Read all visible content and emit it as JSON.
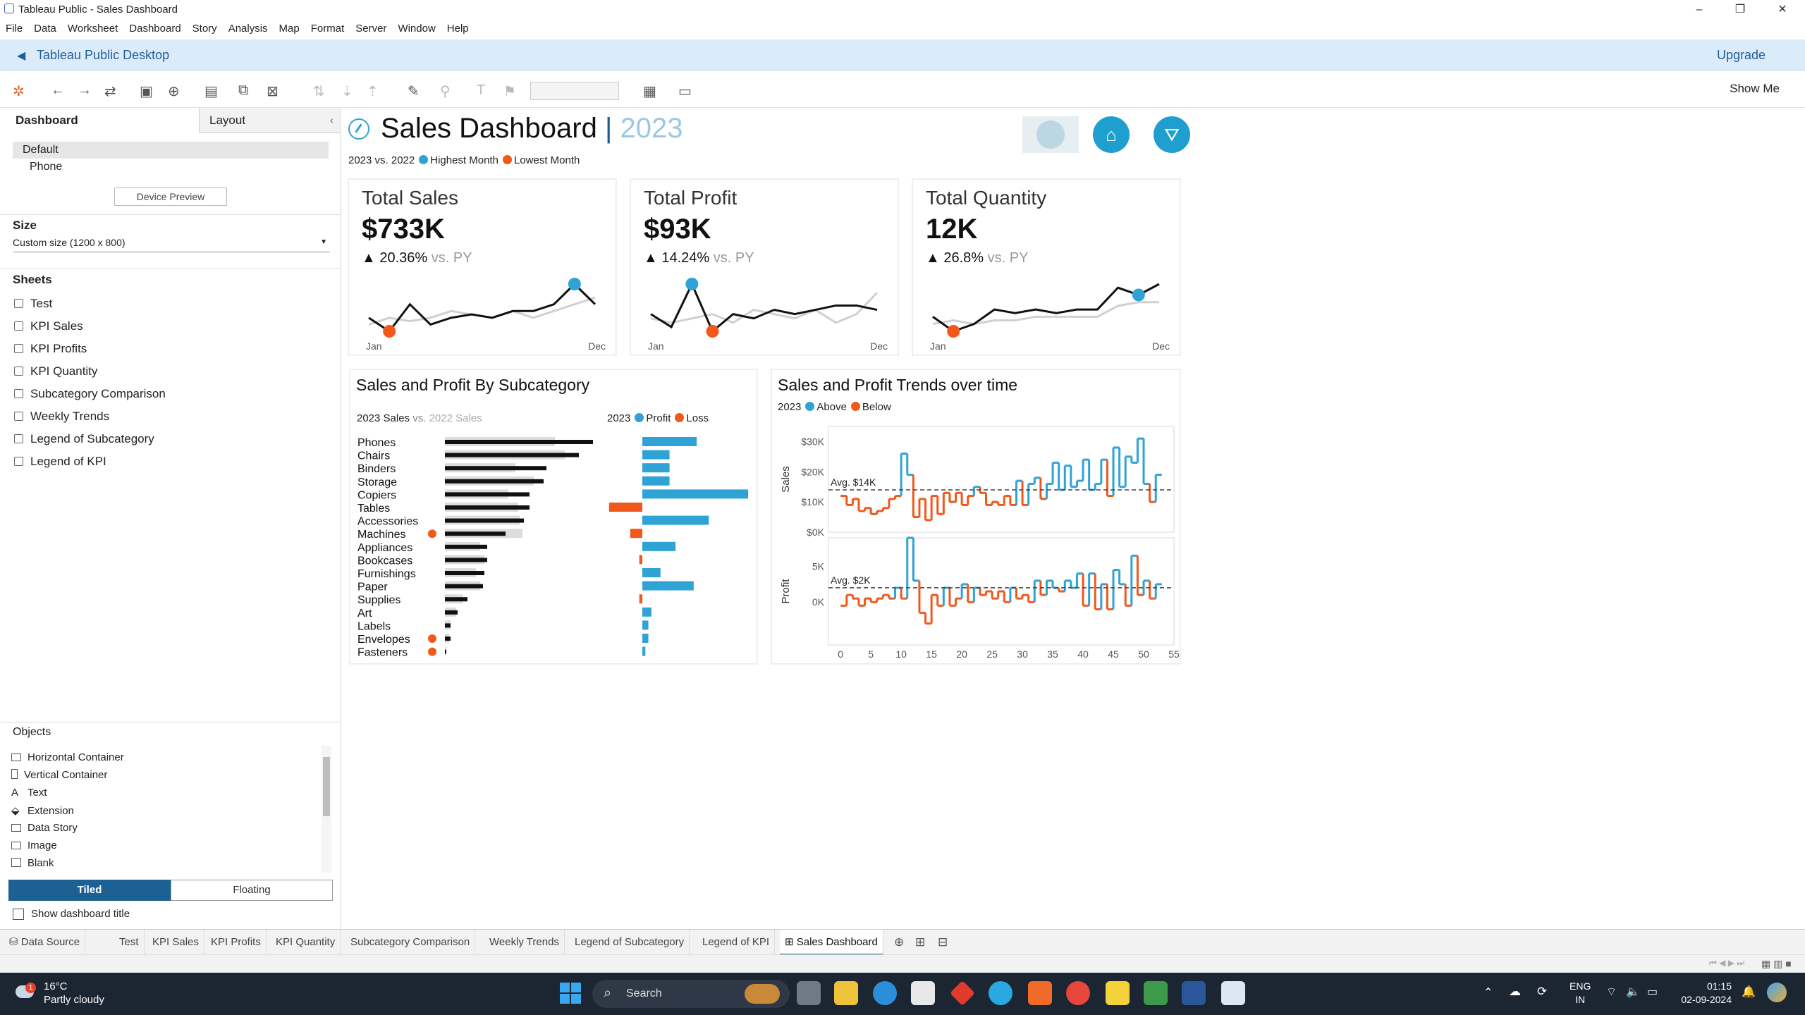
{
  "window": {
    "title": "Tableau Public - Sales Dashboard",
    "minimize": "–",
    "maximize": "❐",
    "close": "✕"
  },
  "menu": [
    "File",
    "Data",
    "Worksheet",
    "Dashboard",
    "Story",
    "Analysis",
    "Map",
    "Format",
    "Server",
    "Window",
    "Help"
  ],
  "banner": {
    "brand": "Tableau Public Desktop",
    "upgrade": "Upgrade"
  },
  "toolbar": {
    "show_me": "Show Me"
  },
  "left": {
    "tab_dashboard": "Dashboard",
    "tab_layout": "Layout",
    "devices": [
      "Default",
      "Phone"
    ],
    "device_preview": "Device Preview",
    "size_heading": "Size",
    "size_value": "Custom size (1200 x 800)",
    "sheets_heading": "Sheets",
    "sheets": [
      "Test",
      "KPI Sales",
      "KPI Profits",
      "KPI Quantity",
      "Subcategory Comparison",
      "Weekly Trends",
      "Legend of Subcategory",
      "Legend of KPI"
    ],
    "objects_heading": "Objects",
    "objects": [
      "Horizontal Container",
      "Vertical Container",
      "Text",
      "Extension",
      "Data Story",
      "Image",
      "Blank"
    ],
    "tiled": "Tiled",
    "floating": "Floating",
    "show_title": "Show dashboard title"
  },
  "dashboard": {
    "title": "Sales Dashboard",
    "separator": "|",
    "year": "2023",
    "subtitle": {
      "compare": "2023 vs. 2022",
      "highest": "Highest Month",
      "lowest": "Lowest Month"
    },
    "colors": {
      "blue": "#2fa3d6",
      "orange": "#f0581c",
      "black": "#111111",
      "grey": "#d0d0d0"
    },
    "kpis": [
      {
        "title": "Total Sales",
        "value": "$733K",
        "change": "▲ 20.36%",
        "vs": "vs. PY",
        "start": "Jan",
        "end": "Dec",
        "current": [
          4,
          2,
          6,
          3,
          4,
          4.5,
          4,
          5,
          5,
          6,
          9,
          6
        ],
        "previous": [
          3,
          4,
          3.5,
          4,
          5,
          4.5,
          4,
          5,
          4,
          5,
          6,
          7
        ],
        "high_index": 10,
        "low_index": 1
      },
      {
        "title": "Total Profit",
        "value": "$93K",
        "change": "▲ 14.24%",
        "vs": "vs. PY",
        "start": "Jan",
        "end": "Dec",
        "current": [
          5,
          2,
          12,
          1,
          5,
          4,
          6,
          5,
          6,
          7,
          7,
          6
        ],
        "previous": [
          4,
          3,
          4,
          5,
          3,
          6,
          5,
          4,
          6,
          3,
          5,
          10
        ],
        "high_index": 2,
        "low_index": 3
      },
      {
        "title": "Total Quantity",
        "value": "12K",
        "change": "▲ 26.8%",
        "vs": "vs. PY",
        "start": "Jan",
        "end": "Dec",
        "current": [
          4,
          2,
          3,
          5,
          4.5,
          5,
          4.5,
          5,
          5,
          8,
          7,
          8.5
        ],
        "previous": [
          3,
          3.5,
          3,
          3.5,
          3.5,
          4,
          4,
          4,
          4,
          5.5,
          6,
          6
        ],
        "high_index": 10,
        "low_index": 1
      }
    ],
    "subcat": {
      "title": "Sales and Profit By Subcategory",
      "legend_sales": "2023 Sales",
      "legend_vs": "vs.",
      "legend_prev": "2022 Sales",
      "legend_year": "2023",
      "legend_profit": "Profit",
      "legend_loss": "Loss",
      "chart_data": {
        "type": "bar",
        "categories": [
          "Phones",
          "Chairs",
          "Binders",
          "Storage",
          "Copiers",
          "Tables",
          "Accessories",
          "Machines",
          "Appliances",
          "Bookcases",
          "Furnishings",
          "Paper",
          "Supplies",
          "Art",
          "Labels",
          "Envelopes",
          "Fasteners"
        ],
        "sales_2023": [
          105,
          95,
          72,
          70,
          60,
          60,
          56,
          43,
          30,
          30,
          28,
          27,
          16,
          9,
          4,
          4,
          1
        ],
        "sales_2022": [
          78,
          85,
          50,
          63,
          45,
          52,
          53,
          55,
          25,
          28,
          22,
          25,
          13,
          8,
          4,
          3,
          1
        ],
        "profit": [
          18,
          9,
          9,
          9,
          35,
          -11,
          22,
          -4,
          11,
          -1,
          6,
          17,
          -1,
          3,
          2,
          2,
          1
        ],
        "dot_categories": [
          "Machines",
          "Envelopes",
          "Fasteners"
        ]
      }
    },
    "trends": {
      "title": "Sales and Profit Trends over time",
      "legend_year": "2023",
      "legend_above": "Above",
      "legend_below": "Below",
      "sales_label": "Sales",
      "profit_label": "Profit",
      "sales_avg_label": "Avg. $14K",
      "profit_avg_label": "Avg. $2K",
      "sales_ticks": [
        "$30K",
        "$20K",
        "$10K",
        "$0K"
      ],
      "profit_ticks": [
        "5K",
        "0K"
      ],
      "x_ticks": [
        "0",
        "5",
        "10",
        "15",
        "20",
        "25",
        "30",
        "35",
        "40",
        "45",
        "50",
        "55"
      ],
      "chart_data": {
        "type": "line",
        "x": [
          0,
          1,
          2,
          3,
          4,
          5,
          6,
          7,
          8,
          9,
          10,
          11,
          12,
          13,
          14,
          15,
          16,
          17,
          18,
          19,
          20,
          21,
          22,
          23,
          24,
          25,
          26,
          27,
          28,
          29,
          30,
          31,
          32,
          33,
          34,
          35,
          36,
          37,
          38,
          39,
          40,
          41,
          42,
          43,
          44,
          45,
          46,
          47,
          48,
          49,
          50,
          51,
          52
        ],
        "sales": [
          12,
          9,
          11,
          7,
          8,
          6,
          7,
          8,
          11,
          12,
          26,
          19,
          5,
          11,
          4,
          12,
          6,
          13,
          10,
          13,
          9,
          12,
          15,
          13,
          9,
          10,
          9,
          12,
          9,
          17,
          9,
          16,
          18,
          11,
          16,
          23,
          14,
          22,
          15,
          17,
          24,
          14,
          16,
          24,
          12,
          28,
          15,
          25,
          23,
          31,
          16,
          10,
          19
        ],
        "sales_avg": 14,
        "profit": [
          -0.5,
          1,
          0.5,
          -0.5,
          0.5,
          0,
          0.5,
          1,
          0.5,
          2,
          0.5,
          9,
          3,
          -1.5,
          -3,
          1,
          -0.5,
          2,
          -0.5,
          0.5,
          2.5,
          0,
          2,
          1,
          1.5,
          0.5,
          1.5,
          0,
          2,
          0.5,
          1,
          0,
          3,
          1,
          3,
          2,
          1.5,
          3,
          2,
          4,
          -0.5,
          4,
          -1,
          2.5,
          -1,
          4.5,
          2.5,
          -0.5,
          6.5,
          1,
          3,
          0.5,
          2.5
        ],
        "profit_avg": 2,
        "ylim_sales": [
          0,
          35
        ],
        "ylim_profit": [
          -6,
          9
        ],
        "xlim": [
          -2,
          55
        ]
      }
    }
  },
  "sheet_tabs": [
    "Data Source",
    "Test",
    "KPI Sales",
    "KPI Profits",
    "KPI Quantity",
    "Subcategory Comparison",
    "Weekly Trends",
    "Legend of Subcategory",
    "Legend of KPI",
    "Sales Dashboard"
  ],
  "taskbar": {
    "temp": "16°C",
    "weather": "Partly cloudy",
    "search": "Search",
    "lang1": "ENG",
    "lang2": "IN",
    "time": "01:15",
    "date": "02-09-2024",
    "badge": "1"
  }
}
